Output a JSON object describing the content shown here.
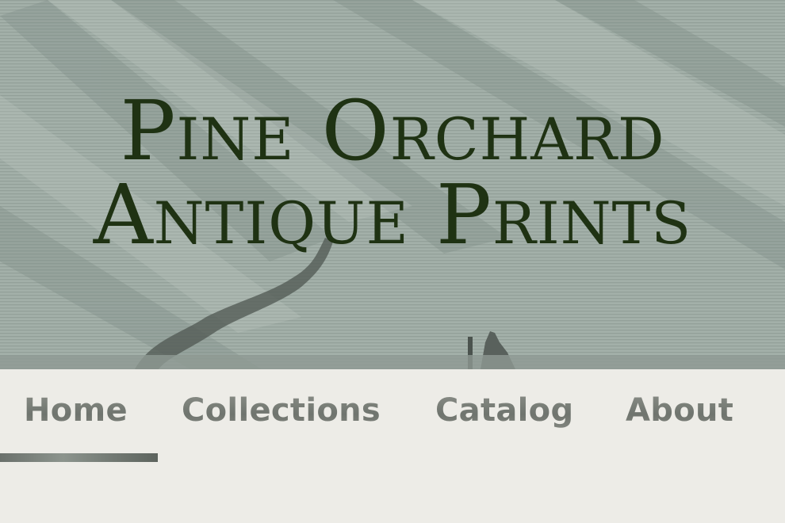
{
  "header": {
    "title_line1": "Pine Orchard",
    "title_line2": "Antique Prints"
  },
  "nav": {
    "items": [
      {
        "label": "Home",
        "active": true
      },
      {
        "label": "Collections",
        "active": false
      },
      {
        "label": "Catalog",
        "active": false
      },
      {
        "label": "About",
        "active": false
      }
    ]
  },
  "colors": {
    "title": "#1f3213",
    "nav_text": "#7b7f79",
    "nav_background": "#edece7",
    "hero_tint": "#9aa8a1"
  }
}
